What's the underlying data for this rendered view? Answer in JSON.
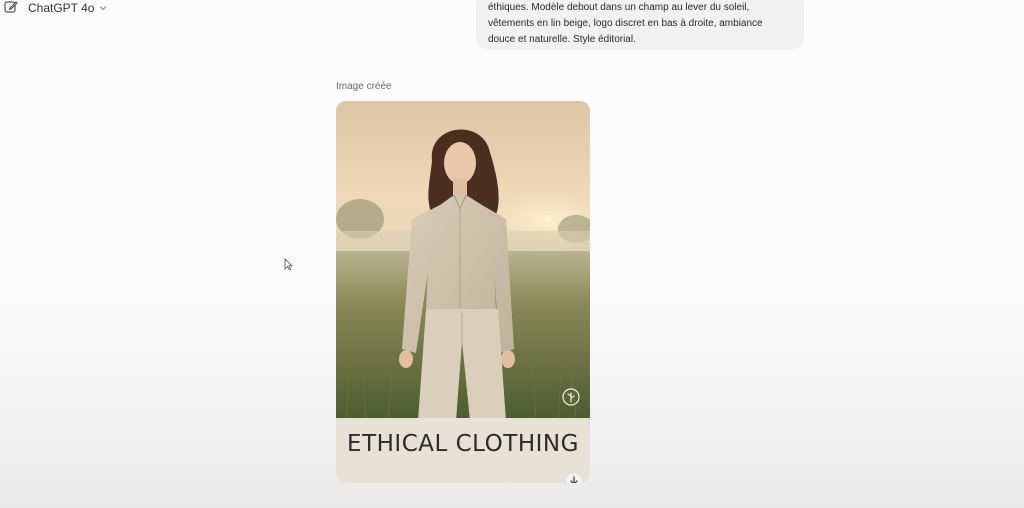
{
  "header": {
    "model_name": "ChatGPT 4o",
    "icons": {
      "new_chat": "edit-icon",
      "dropdown": "chevron-down-icon"
    }
  },
  "user_message": {
    "lines": [
      "éthiques. Modèle debout dans un champ au lever du soleil,",
      "vêtements en lin beige, logo discret en bas à droite, ambiance",
      "douce et naturelle. Style éditorial."
    ]
  },
  "assistant": {
    "caption": "Image créée",
    "image": {
      "brand_text": "ETHICAL CLOTHING",
      "icons": {
        "logo": "leaf-logo-icon",
        "download": "download-icon"
      }
    }
  },
  "colors": {
    "bubble": "#f1f1f1",
    "caption": "#6b6b6b",
    "brand_band": "#e8e2d6"
  }
}
